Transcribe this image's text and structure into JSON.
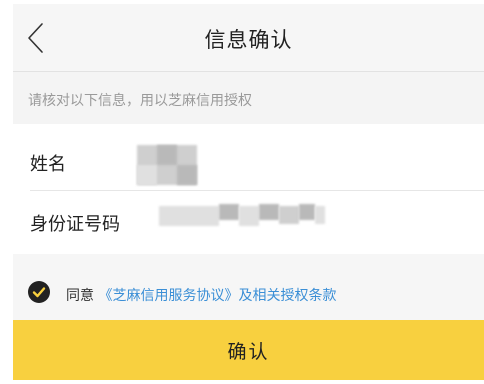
{
  "header": {
    "title": "信息确认",
    "back_icon": "chevron-left-icon"
  },
  "tip": {
    "text": "请核对以下信息，用以芝麻信用授权"
  },
  "fields": {
    "name_label": "姓名",
    "id_label": "身份证号码"
  },
  "agreement": {
    "prefix": "同意",
    "link_text": "《芝麻信用服务协议》及相关授权条款",
    "check_icon": "check-circle-icon",
    "checked": true
  },
  "confirm_button": {
    "label": "确认"
  },
  "colors": {
    "accent_yellow": "#F8D03F",
    "link_blue": "#3B8FD6",
    "check_background": "#222222",
    "check_mark": "#F8D03F"
  }
}
